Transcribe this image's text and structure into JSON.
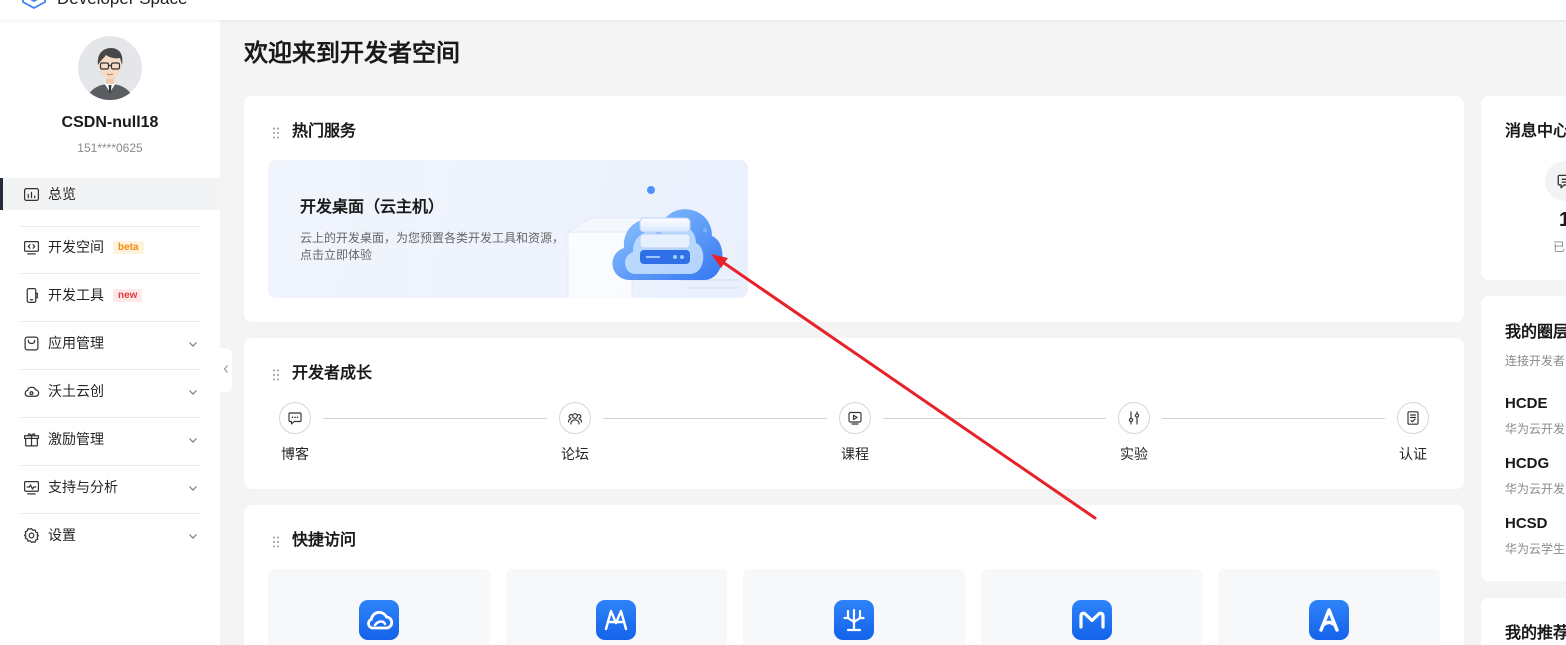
{
  "header": {
    "brand": "Developer Space"
  },
  "user": {
    "name": "CSDN-null18",
    "phone": "151****0625"
  },
  "nav": [
    {
      "label": "总览",
      "icon": "overview-chart-icon",
      "active": true
    },
    {
      "label": "开发空间",
      "icon": "code-monitor-icon",
      "badge": "beta"
    },
    {
      "label": "开发工具",
      "icon": "device-icon",
      "badge": "new"
    },
    {
      "label": "应用管理",
      "icon": "app-icon",
      "expandable": true
    },
    {
      "label": "沃土云创",
      "icon": "cloud-icon",
      "expandable": true
    },
    {
      "label": "激励管理",
      "icon": "gift-icon",
      "expandable": true
    },
    {
      "label": "支持与分析",
      "icon": "analytics-monitor-icon",
      "expandable": true
    },
    {
      "label": "设置",
      "icon": "gear-icon",
      "expandable": true
    }
  ],
  "page_title": "欢迎来到开发者空间",
  "hot_services": {
    "title": "热门服务",
    "card": {
      "title": "开发桌面（云主机）",
      "desc_line1": "云上的开发桌面，为您预置各类开发工具和资源，",
      "desc_line2": "点击立即体验"
    }
  },
  "growth": {
    "title": "开发者成长",
    "steps": [
      {
        "label": "博客",
        "icon": "chat-icon"
      },
      {
        "label": "论坛",
        "icon": "community-icon"
      },
      {
        "label": "课程",
        "icon": "video-play-icon"
      },
      {
        "label": "实验",
        "icon": "sliders-icon"
      },
      {
        "label": "认证",
        "icon": "certificate-icon"
      }
    ]
  },
  "quick_access": {
    "title": "快捷访问",
    "tiles": [
      {
        "icon": "cloud-swoosh-icon"
      },
      {
        "icon": "mountain-m-icon"
      },
      {
        "icon": "tree-circuit-icon"
      },
      {
        "icon": "m-logo-icon"
      },
      {
        "icon": "a-logo-icon"
      }
    ]
  },
  "messages": {
    "title": "消息中心",
    "count": "1",
    "status": "已"
  },
  "circles": {
    "title": "我的圈层",
    "subtitle": "连接开发者",
    "items": [
      {
        "name": "HCDE",
        "desc": "华为云开发"
      },
      {
        "name": "HCDG",
        "desc": "华为云开发"
      },
      {
        "name": "HCSD",
        "desc": "华为云学生"
      }
    ]
  },
  "recommend": {
    "title": "我的推荐"
  },
  "colors": {
    "accent": "#1e6ff2",
    "badge_beta": "#f58a0c",
    "badge_new": "#e33b3b",
    "annotation_arrow": "#e8222a",
    "page_bg": "#f4f4f5"
  }
}
